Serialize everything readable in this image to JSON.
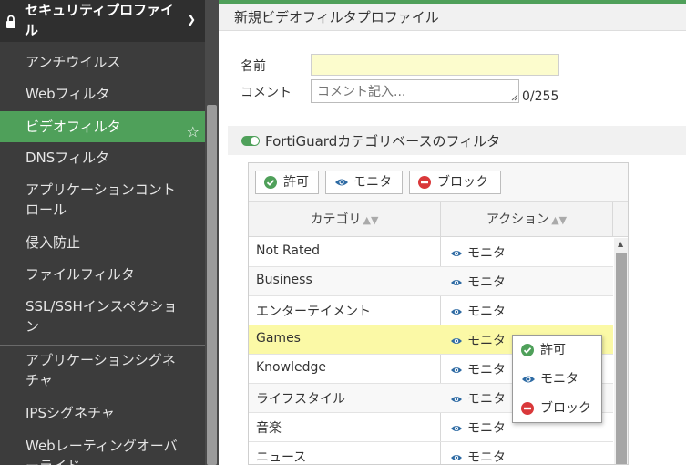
{
  "sidebar": {
    "section_title": "セキュリティプロファイル",
    "items": [
      {
        "label": "アンチウイルス"
      },
      {
        "label": "Webフィルタ"
      },
      {
        "label": "ビデオフィルタ"
      },
      {
        "label": "DNSフィルタ"
      },
      {
        "label": "アプリケーションコントロール"
      },
      {
        "label": "侵入防止"
      },
      {
        "label": "ファイルフィルタ"
      },
      {
        "label": "SSL/SSHインスペクション"
      },
      {
        "label": "アプリケーションシグネチャ"
      },
      {
        "label": "IPSシグネチャ"
      },
      {
        "label": "Webレーティングオーバーライド"
      }
    ]
  },
  "page": {
    "title": "新規ビデオフィルタプロファイル"
  },
  "form": {
    "name_label": "名前",
    "name_value": "",
    "comment_label": "コメント",
    "comment_placeholder": "コメント記入...",
    "char_count": "0/255"
  },
  "section": {
    "title": "FortiGuardカテゴリベースのフィルタ"
  },
  "toolbar": {
    "allow_label": "許可",
    "monitor_label": "モニタ",
    "block_label": "ブロック"
  },
  "table": {
    "headers": {
      "category": "カテゴリ",
      "action": "アクション"
    },
    "rows": [
      {
        "category": "Not Rated",
        "action": "モニタ"
      },
      {
        "category": "Business",
        "action": "モニタ"
      },
      {
        "category": "エンターテイメント",
        "action": "モニタ"
      },
      {
        "category": "Games",
        "action": "モニタ"
      },
      {
        "category": "Knowledge",
        "action": "モニタ"
      },
      {
        "category": "ライフスタイル",
        "action": "モニタ"
      },
      {
        "category": "音楽",
        "action": "モニタ"
      },
      {
        "category": "ニュース",
        "action": "モニタ"
      }
    ]
  },
  "popup": {
    "allow": "許可",
    "monitor": "モニタ",
    "block": "ブロック"
  },
  "colors": {
    "accent_green": "#4fa05a",
    "highlight_yellow": "#fbf9a6",
    "block_red": "#d9383a",
    "monitor_blue": "#2d6aa3"
  }
}
